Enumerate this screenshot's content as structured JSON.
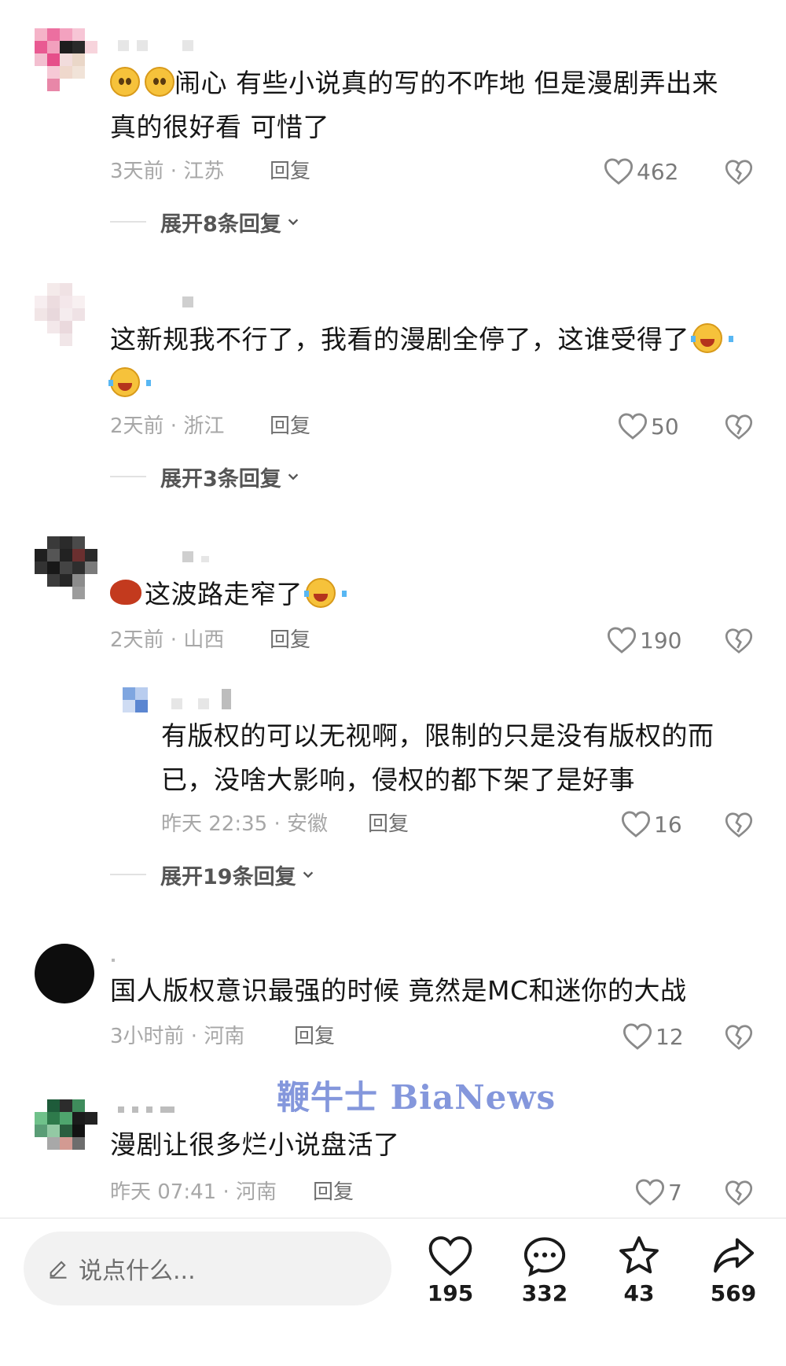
{
  "comments": [
    {
      "text_before": "",
      "text": "闹心 有些小说真的写的不咋地 但是漫剧弄出来真的很好看 可惜了",
      "time_loc": "3天前 · 江苏",
      "reply_label": "回复",
      "likes": "462",
      "expand_label": "展开8条回复"
    },
    {
      "text": "这新规我不行了，我看的漫剧全停了，这谁受得了",
      "time_loc": "2天前 · 浙江",
      "reply_label": "回复",
      "likes": "50",
      "expand_label": "展开3条回复"
    },
    {
      "text": "这波路走窄了",
      "time_loc": "2天前 · 山西",
      "reply_label": "回复",
      "likes": "190",
      "reply": {
        "text": "有版权的可以无视啊，限制的只是没有版权的而已，没啥大影响，侵权的都下架了是好事",
        "time_loc": "昨天 22:35 · 安徽",
        "reply_label": "回复",
        "likes": "16"
      },
      "expand_label": "展开19条回复"
    },
    {
      "text": "国人版权意识最强的时候 竟然是MC和迷你的大战",
      "time_loc": "3小时前 · 河南",
      "reply_label": "回复",
      "likes": "12"
    },
    {
      "text": "漫剧让很多烂小说盘活了",
      "time_loc": "昨天 07:41 · 河南",
      "reply_label": "回复",
      "likes": "7"
    }
  ],
  "watermark": "鞭牛士 BiaNews",
  "bottom_bar": {
    "input_placeholder": "说点什么...",
    "like_count": "195",
    "comment_count": "332",
    "favorite_count": "43",
    "share_count": "569"
  },
  "colors": {
    "like_icon": "#8a8a8a",
    "watermark": "#6f86d6",
    "input_bg": "#f2f2f2"
  }
}
